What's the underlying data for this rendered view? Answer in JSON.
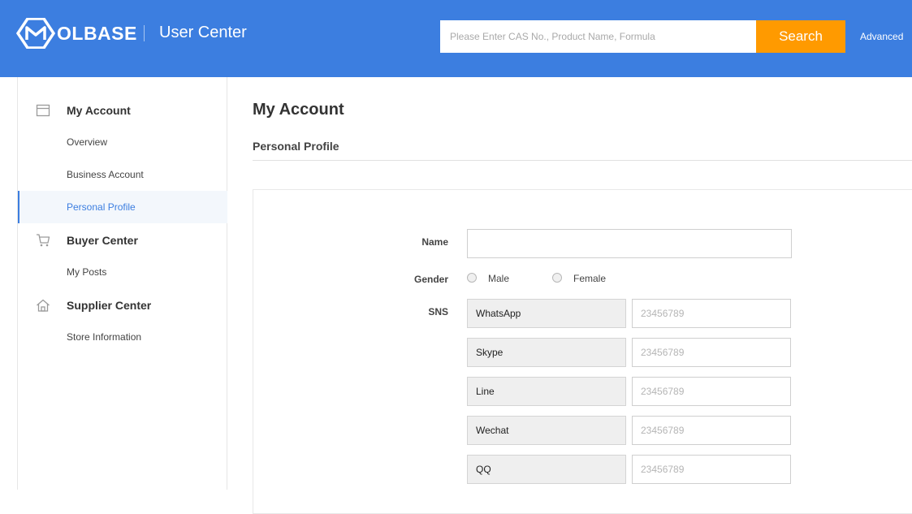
{
  "header": {
    "brand": "OLBASE",
    "subtitle": "User Center",
    "search_placeholder": "Please Enter CAS No., Product Name, Formula",
    "search_button": "Search",
    "advanced_link": "Advanced"
  },
  "sidebar": {
    "groups": [
      {
        "title": "My Account",
        "icon": "account-card-icon",
        "items": [
          "Overview",
          "Business Account",
          "Personal Profile"
        ]
      },
      {
        "title": "Buyer Center",
        "icon": "cart-icon",
        "items": [
          "My Posts"
        ]
      },
      {
        "title": "Supplier Center",
        "icon": "home-icon",
        "items": [
          "Store Information"
        ]
      }
    ],
    "active_item": "Personal Profile"
  },
  "main": {
    "page_title": "My Account",
    "section_title": "Personal Profile",
    "form": {
      "name_label": "Name",
      "name_value": "",
      "gender_label": "Gender",
      "gender_options": [
        "Male",
        "Female"
      ],
      "sns_label": "SNS",
      "sns_rows": [
        {
          "type": "WhatsApp",
          "placeholder": "23456789"
        },
        {
          "type": "Skype",
          "placeholder": "23456789"
        },
        {
          "type": "Line",
          "placeholder": "23456789"
        },
        {
          "type": "Wechat",
          "placeholder": "23456789"
        },
        {
          "type": "QQ",
          "placeholder": "23456789"
        }
      ]
    }
  },
  "colors": {
    "header_bg": "#3c7ee0",
    "search_button_bg": "#ff9a00",
    "active_text": "#3c7ee0"
  }
}
